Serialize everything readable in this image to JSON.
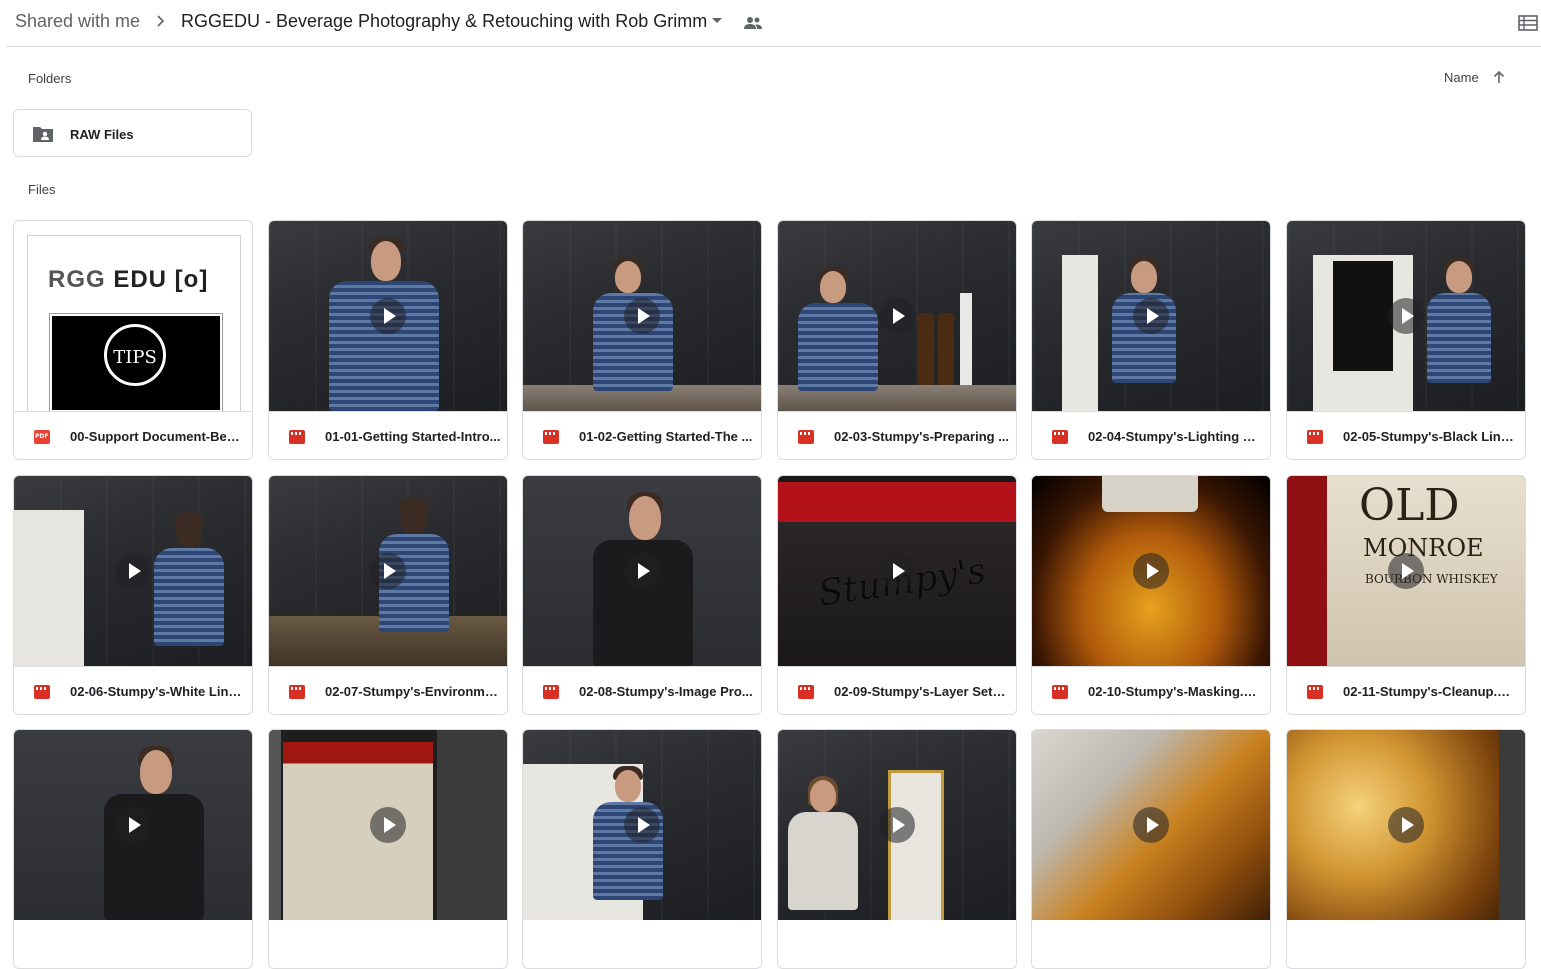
{
  "header": {
    "root_crumb": "Shared with me",
    "folder_title": "RGGEDU - Beverage Photography & Retouching with Rob Grimm"
  },
  "sections": {
    "folders_label": "Folders",
    "files_label": "Files",
    "sort_label": "Name"
  },
  "folders": [
    {
      "name": "RAW Files"
    }
  ],
  "support_thumb": {
    "brand_left": "RGG",
    "brand_right": "EDU [o]",
    "seal_text": "TIPS"
  },
  "files": [
    {
      "name": "00-Support Document-Beve...",
      "type": "pdf"
    },
    {
      "name": "01-01-Getting Started-Intro...",
      "type": "video"
    },
    {
      "name": "01-02-Getting Started-The ...",
      "type": "video"
    },
    {
      "name": "02-03-Stumpy's-Preparing ...",
      "type": "video"
    },
    {
      "name": "02-04-Stumpy's-Lighting Se...",
      "type": "video"
    },
    {
      "name": "02-05-Stumpy's-Black Line....",
      "type": "video"
    },
    {
      "name": "02-06-Stumpy's-White Line....",
      "type": "video"
    },
    {
      "name": "02-07-Stumpy's-Environme...",
      "type": "video"
    },
    {
      "name": "02-08-Stumpy's-Image Pro...",
      "type": "video"
    },
    {
      "name": "02-09-Stumpy's-Layer Setu...",
      "type": "video"
    },
    {
      "name": "02-10-Stumpy's-Masking.m...",
      "type": "video"
    },
    {
      "name": "02-11-Stumpy's-Cleanup.m...",
      "type": "video"
    }
  ],
  "thumb_text": {
    "stumpys": "Stumpy's",
    "old": "OLD",
    "monroe": "MONROE",
    "bourbon": "BOURBON WHISKEY"
  },
  "colors": {
    "accent_red": "#d93025",
    "border": "#dadce0",
    "text": "#202124"
  }
}
